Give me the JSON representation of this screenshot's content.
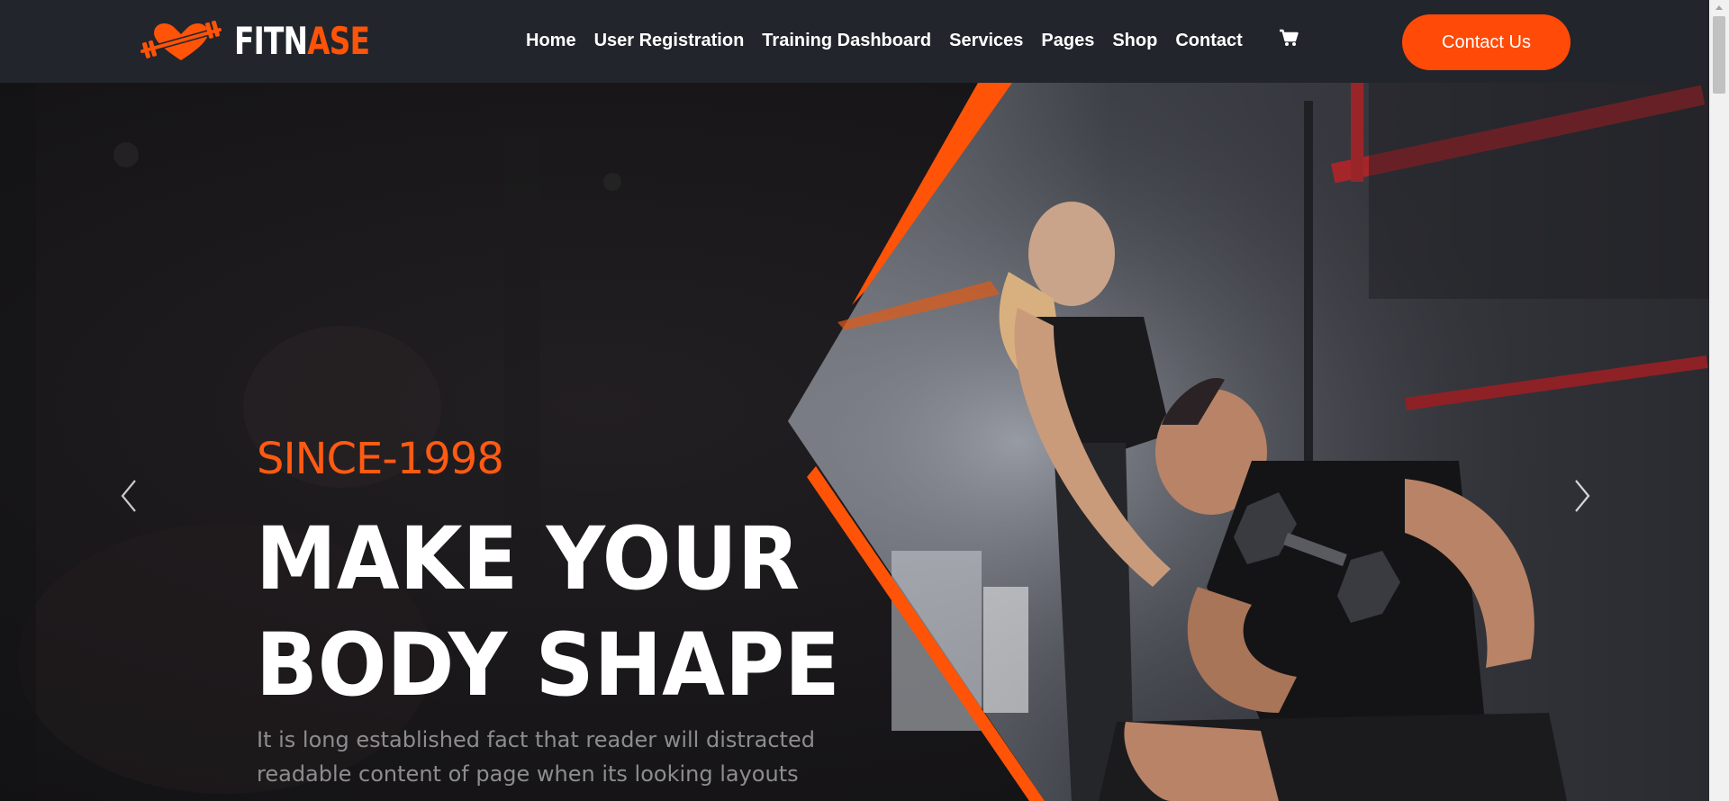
{
  "brand": {
    "name_part1": "FITN",
    "name_part2": "ASE"
  },
  "nav": {
    "items": [
      {
        "label": "Home"
      },
      {
        "label": "User Registration"
      },
      {
        "label": "Training Dashboard"
      },
      {
        "label": "Services"
      },
      {
        "label": "Pages"
      },
      {
        "label": "Shop"
      },
      {
        "label": "Contact"
      }
    ],
    "cart_icon": "shopping-cart-icon"
  },
  "header": {
    "contact_button": "Contact Us"
  },
  "hero": {
    "eyebrow": "SINCE-1998",
    "headline_line1": "MAKE YOUR",
    "headline_line2": "BODY SHAPE",
    "subtext": "It is long established fact that reader will distracted readable content of page when its looking layouts",
    "prev_icon": "chevron-left-icon",
    "next_icon": "chevron-right-icon"
  },
  "colors": {
    "accent": "#ff4a08",
    "header_bg": "#22252b",
    "hero_bg": "#161416"
  }
}
